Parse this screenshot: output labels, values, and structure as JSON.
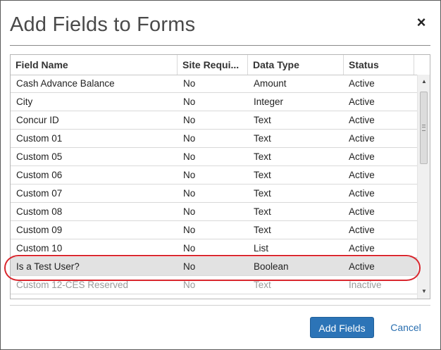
{
  "dialog": {
    "title": "Add Fields to Forms",
    "close_glyph": "×"
  },
  "grid": {
    "columns": [
      "Field Name",
      "Site Requi...",
      "Data Type",
      "Status"
    ],
    "rows": [
      {
        "name": "Cash Advance Balance",
        "site": "No",
        "type": "Amount",
        "status": "Active"
      },
      {
        "name": "City",
        "site": "No",
        "type": "Integer",
        "status": "Active"
      },
      {
        "name": "Concur ID",
        "site": "No",
        "type": "Text",
        "status": "Active"
      },
      {
        "name": "Custom 01",
        "site": "No",
        "type": "Text",
        "status": "Active"
      },
      {
        "name": "Custom 05",
        "site": "No",
        "type": "Text",
        "status": "Active"
      },
      {
        "name": "Custom 06",
        "site": "No",
        "type": "Text",
        "status": "Active"
      },
      {
        "name": "Custom 07",
        "site": "No",
        "type": "Text",
        "status": "Active"
      },
      {
        "name": "Custom 08",
        "site": "No",
        "type": "Text",
        "status": "Active"
      },
      {
        "name": "Custom 09",
        "site": "No",
        "type": "Text",
        "status": "Active"
      },
      {
        "name": "Custom 10",
        "site": "No",
        "type": "List",
        "status": "Active"
      },
      {
        "name": "Is a Test User?",
        "site": "No",
        "type": "Boolean",
        "status": "Active"
      },
      {
        "name": "Custom 12-CES Reserved",
        "site": "No",
        "type": "Text",
        "status": "Inactive"
      }
    ],
    "selected_row": 10,
    "inactive_row": 11
  },
  "footer": {
    "primary_label": "Add Fields",
    "cancel_label": "Cancel"
  },
  "colors": {
    "primary_button": "#2c74b7",
    "highlight_ring": "#d9272e",
    "link": "#2a6fb0"
  },
  "icons": {
    "close": "close-icon",
    "scroll_up": "scroll-up-arrow-icon",
    "scroll_down": "scroll-down-arrow-icon"
  }
}
